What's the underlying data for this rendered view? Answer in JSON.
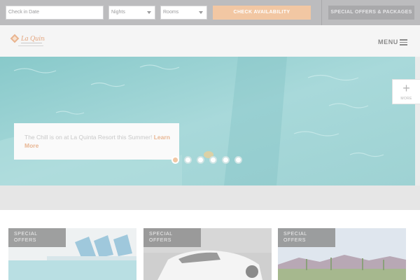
{
  "booking": {
    "checkin_placeholder": "Check in Date",
    "nights_label": "Nights",
    "rooms_label": "Rooms",
    "check_button": "CHECK AVAILABILITY",
    "offers_button": "SPECIAL OFFERS & PACKAGES"
  },
  "header": {
    "logo_text": "La Quinta",
    "menu_label": "MENU"
  },
  "hero": {
    "caption": "The Chill is on at La Quinta Resort this Summer!",
    "link": "Learn More",
    "slides": 6,
    "active_slide": 1
  },
  "more_tab": {
    "plus": "+",
    "label": "MORE"
  },
  "cards": [
    {
      "label_line1": "SPECIAL",
      "label_line2": "OFFERS"
    },
    {
      "label_line1": "SPECIAL",
      "label_line2": "OFFERS"
    },
    {
      "label_line1": "SPECIAL",
      "label_line2": "OFFERS"
    }
  ],
  "colors": {
    "accent": "#f2c7a3",
    "link": "#e8b693",
    "water": "#9fd3d4"
  }
}
